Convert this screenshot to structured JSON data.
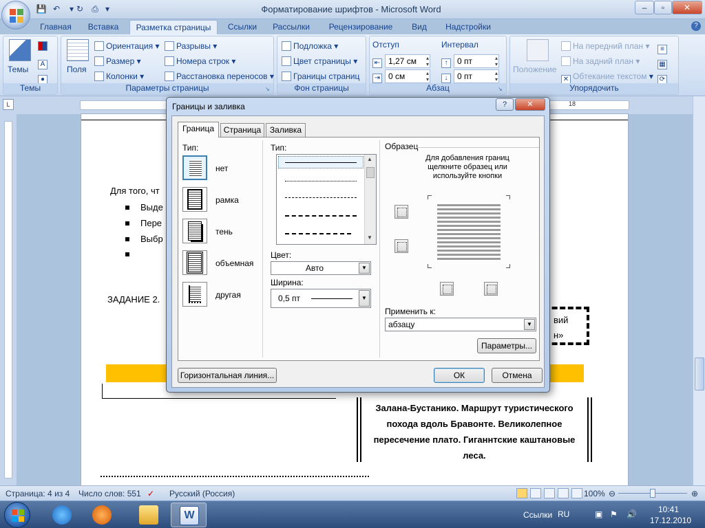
{
  "window": {
    "title": "Форматирование шрифтов - Microsoft Word",
    "min": "–",
    "max": "▫",
    "close": "✕"
  },
  "tabs": [
    "Главная",
    "Вставка",
    "Разметка страницы",
    "Ссылки",
    "Рассылки",
    "Рецензирование",
    "Вид",
    "Надстройки"
  ],
  "active_tab": "Разметка страницы",
  "ribbon": {
    "themes": {
      "label": "Темы",
      "button": "Темы"
    },
    "page_setup": {
      "label": "Параметры страницы",
      "fields": "Поля",
      "orientation": "Ориентация",
      "size": "Размер",
      "columns": "Колонки",
      "breaks": "Разрывы",
      "line_numbers": "Номера строк",
      "hyphenation": "Расстановка переносов"
    },
    "page_background": {
      "label": "Фон страницы",
      "watermark": "Подложка",
      "page_color": "Цвет страницы",
      "page_borders": "Границы страниц"
    },
    "paragraph": {
      "label": "Абзац",
      "indent": "Отступ",
      "spacing": "Интервал",
      "indent_left": "1,27 см",
      "indent_right": "0 см",
      "spacing_before": "0 пт",
      "spacing_after": "0 пт"
    },
    "arrange": {
      "label": "Упорядочить",
      "position": "Положение",
      "bring_front": "На передний план",
      "send_back": "На задний план",
      "text_wrap": "Обтекание текстом"
    }
  },
  "ruler": {
    "mark": "18"
  },
  "document": {
    "intro": "Для того, чт",
    "bullets": [
      "Выде",
      "Пере",
      "Выбр",
      ""
    ],
    "task": "ЗАДАНИЕ 2.",
    "right_frag1": "вий",
    "right_frag2": "н»",
    "tour_text": "Залана-Бустанико. Маршрут туристического похода вдоль Бравонте. Великолепное пересечение плато. Гиганнтские каштановые леса."
  },
  "status": {
    "page": "Страница: 4 из 4",
    "words": "Число слов: 551",
    "language": "Русский (Россия)",
    "zoom": "100%"
  },
  "taskbar": {
    "tray_label": "Ссылки",
    "lang": "RU",
    "time": "10:41",
    "date": "17.12.2010"
  },
  "dialog": {
    "title": "Границы и заливка",
    "help": "?",
    "close": "✕",
    "tabs": [
      "Граница",
      "Страница",
      "Заливка"
    ],
    "active_tab": "Граница",
    "type_label": "Тип:",
    "settings": [
      "нет",
      "рамка",
      "тень",
      "объемная",
      "другая"
    ],
    "selected_setting": "нет",
    "style_label": "Тип:",
    "color_label": "Цвет:",
    "color_value": "Авто",
    "width_label": "Ширина:",
    "width_value": "0,5 пт",
    "preview_label": "Образец",
    "preview_hint": "Для добавления границ щелкните образец или используйте кнопки",
    "apply_label": "Применить к:",
    "apply_value": "абзацу",
    "options_button": "Параметры...",
    "hline_button": "Горизонтальная линия...",
    "ok_button": "ОК",
    "cancel_button": "Отмена"
  },
  "colors": {
    "yellow_bar": "#ffc000",
    "ribbon_text": "#15428b"
  }
}
